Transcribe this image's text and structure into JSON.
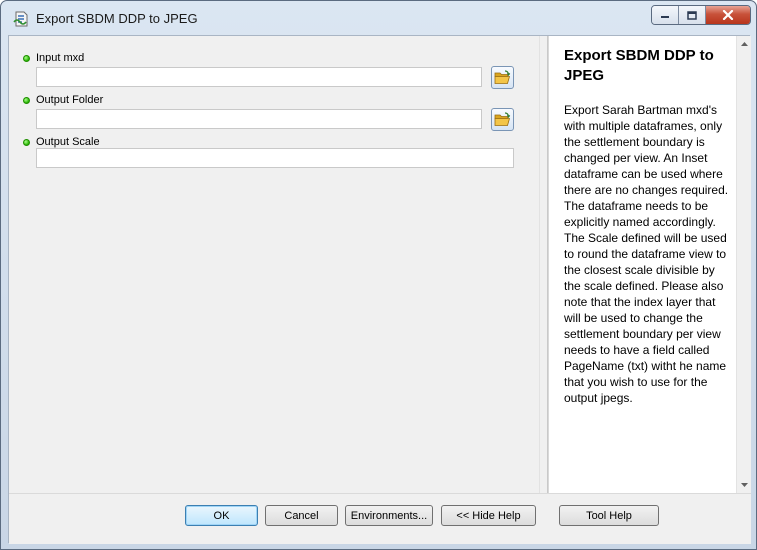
{
  "window": {
    "title": "Export SBDM DDP to JPEG"
  },
  "parameters": [
    {
      "label": "Input mxd",
      "value": "",
      "has_browse": true
    },
    {
      "label": "Output Folder",
      "value": "",
      "has_browse": true
    },
    {
      "label": "Output Scale",
      "value": "",
      "has_browse": false
    }
  ],
  "help": {
    "title": "Export SBDM DDP to JPEG",
    "body": "Export Sarah Bartman mxd's with multiple dataframes, only the settlement boundary is changed per view. An Inset dataframe can be used where there are no changes required. The dataframe needs to be explicitly named accordingly. The Scale defined will be used to round the dataframe view to the closest scale divisible by the scale defined. Please also note that the index layer that will be used to change the settlement boundary per view needs to have a field called PageName (txt) witht he name that you wish to use for the output jpegs."
  },
  "buttons": {
    "ok": "OK",
    "cancel": "Cancel",
    "environments": "Environments...",
    "hide_help": "<< Hide Help",
    "tool_help": "Tool Help"
  },
  "icons": {
    "app": "arctoolbox-script-icon",
    "browse": "folder-open-icon",
    "required": "green-dot-icon"
  }
}
